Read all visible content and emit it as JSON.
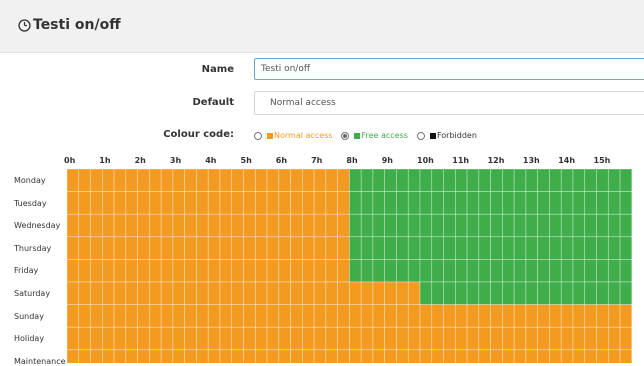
{
  "header": {
    "title": "Testi on/off"
  },
  "form": {
    "name_label": "Name",
    "name_value": "Testi on/off",
    "default_label": "Default",
    "default_value": "Normal access",
    "colour_label": "Colour code:"
  },
  "legend": [
    {
      "label": "Normal access",
      "color": "#f39a21",
      "selected": false
    },
    {
      "label": "Free access",
      "color": "#3fae4a",
      "selected": true
    },
    {
      "label": "Forbidden",
      "color": "#111111",
      "selected": false
    }
  ],
  "schedule": {
    "hours": [
      "0h",
      "1h",
      "2h",
      "3h",
      "4h",
      "5h",
      "6h",
      "7h",
      "8h",
      "9h",
      "10h",
      "11h",
      "12h",
      "13h",
      "14h",
      "15h"
    ],
    "days": [
      {
        "name": "Monday",
        "free": [
          [
            8,
            16
          ]
        ]
      },
      {
        "name": "Tuesday",
        "free": [
          [
            8,
            16
          ]
        ]
      },
      {
        "name": "Wednesday",
        "free": [
          [
            8,
            16
          ]
        ]
      },
      {
        "name": "Thursday",
        "free": [
          [
            8,
            16
          ]
        ]
      },
      {
        "name": "Friday",
        "free": [
          [
            8,
            16
          ]
        ]
      },
      {
        "name": "Saturday",
        "free": [
          [
            10,
            16
          ]
        ]
      },
      {
        "name": "Sunday",
        "free": []
      },
      {
        "name": "Holiday",
        "free": []
      },
      {
        "name": "Maintenance",
        "free": []
      }
    ],
    "colors": {
      "normal": "#f39a21",
      "free": "#3fae4a"
    }
  }
}
